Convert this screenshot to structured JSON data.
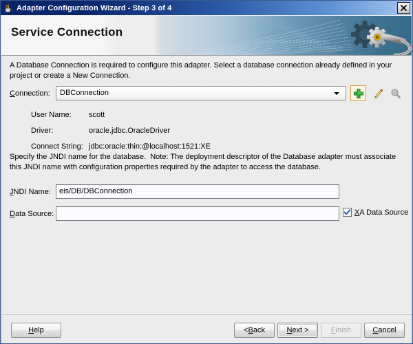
{
  "window": {
    "title": "Adapter Configuration Wizard - Step 3 of 4",
    "title_icon": "java-coffee-cup-icon",
    "close_icon": "close-icon"
  },
  "banner": {
    "title": "Service Connection",
    "art_binary_text": "0101010101010101010101010101",
    "art_binary_text2": "0101010101010",
    "art_icon": "gear-wrench-icon",
    "gradient_from": "#f6f6f6",
    "gradient_to": "#356b88"
  },
  "main": {
    "intro_text": "A Database Connection is required to configure this adapter. Select a database connection already defined in your project or create a New Connection.",
    "connection": {
      "label": "Connection:",
      "label_mnemonic": "C",
      "value": "DBConnection",
      "options": [
        "DBConnection"
      ],
      "create_icon": "plus-icon",
      "edit_icon": "pencil-icon",
      "browse_icon": "magnifier-icon",
      "create_icon_color": "#2aa02a",
      "edit_icon_color": "#e8b40a",
      "browse_icon_color": "#9a9a9a"
    },
    "details": [
      {
        "label": "User Name:",
        "value": "scott"
      },
      {
        "label": "Driver:",
        "value": "oracle.jdbc.OracleDriver"
      },
      {
        "label": "Connect String:",
        "value": "jdbc:oracle:thin:@localhost:1521:XE"
      }
    ],
    "jndi_note": "Specify the JNDI name for the database.  Note: The deployment descriptor of the Database adapter must associate this JNDI name with configuration properties required by the adapter to access the database.",
    "jndi": {
      "label_mnemonic": "J",
      "label_rest": "NDI Name:",
      "value": "eis/DB/DBConnection",
      "placeholder": ""
    },
    "datasource": {
      "label_mnemonic": "D",
      "label_rest": "ata Source:",
      "value": "",
      "placeholder": ""
    },
    "xa_data_source": {
      "label_mnemonic": "X",
      "label_rest": "A Data Source",
      "checked": true,
      "check_color": "#2b5fbe"
    }
  },
  "buttons": {
    "help": {
      "prefix": "",
      "mnemonic": "H",
      "suffix": "elp",
      "state": "enabled"
    },
    "back": {
      "prefix": "< ",
      "mnemonic": "B",
      "suffix": "ack",
      "state": "enabled"
    },
    "next": {
      "prefix": "",
      "mnemonic": "N",
      "suffix": "ext >",
      "state": "focused"
    },
    "finish": {
      "prefix": "",
      "mnemonic": "F",
      "suffix": "inish",
      "state": "disabled"
    },
    "cancel": {
      "prefix": "",
      "mnemonic": "C",
      "suffix": "ancel",
      "state": "enabled"
    }
  }
}
